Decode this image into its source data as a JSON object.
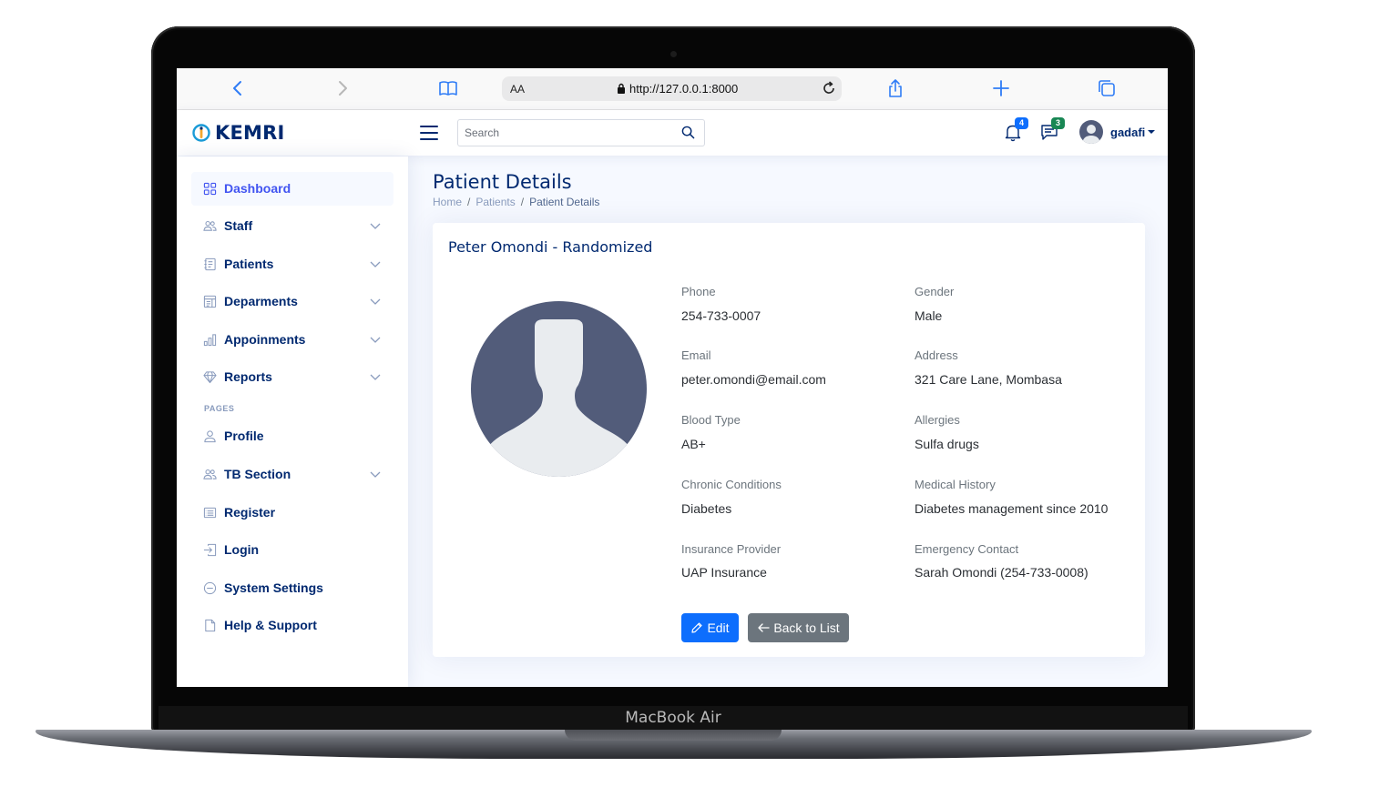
{
  "device": {
    "label": "MacBook Air"
  },
  "browser": {
    "aa_label": "AA",
    "url": "http://127.0.0.1:8000"
  },
  "header": {
    "logo_text": "KEMRI",
    "search_placeholder": "Search",
    "notifications_count": "4",
    "messages_count": "3",
    "user_name": "gadafi",
    "colors": {
      "primary": "#012970",
      "accent": "#4154f1",
      "notif_badge": "#0d6efd",
      "msg_badge": "#198754"
    }
  },
  "sidebar": {
    "items": [
      {
        "label": "Dashboard",
        "icon": "grid-icon",
        "has_children": false,
        "active": true
      },
      {
        "label": "Staff",
        "icon": "people-icon",
        "has_children": true
      },
      {
        "label": "Patients",
        "icon": "journal-text-icon",
        "has_children": true
      },
      {
        "label": "Deparments",
        "icon": "layout-text-window-icon",
        "has_children": true
      },
      {
        "label": "Appoinments",
        "icon": "bar-chart-icon",
        "has_children": true
      },
      {
        "label": "Reports",
        "icon": "gem-icon",
        "has_children": true
      }
    ],
    "pages_heading": "PAGES",
    "pages": [
      {
        "label": "Profile",
        "icon": "person-icon",
        "has_children": false
      },
      {
        "label": "TB Section",
        "icon": "people-icon",
        "has_children": true
      },
      {
        "label": "Register",
        "icon": "card-list-icon",
        "has_children": false
      },
      {
        "label": "Login",
        "icon": "box-arrow-in-right-icon",
        "has_children": false
      },
      {
        "label": "System Settings",
        "icon": "dash-circle-icon",
        "has_children": false
      },
      {
        "label": "Help & Support",
        "icon": "file-icon",
        "has_children": false
      }
    ]
  },
  "main": {
    "page_title": "Patient Details",
    "breadcrumb": [
      "Home",
      "Patients",
      "Patient Details"
    ],
    "card": {
      "title": "Peter Omondi - Randomized",
      "fields": [
        {
          "label": "Phone",
          "value": "254-733-0007"
        },
        {
          "label": "Gender",
          "value": "Male"
        },
        {
          "label": "Email",
          "value": "peter.omondi@email.com"
        },
        {
          "label": "Address",
          "value": "321 Care Lane, Mombasa"
        },
        {
          "label": "Blood Type",
          "value": "AB+"
        },
        {
          "label": "Allergies",
          "value": "Sulfa drugs"
        },
        {
          "label": "Chronic Conditions",
          "value": "Diabetes"
        },
        {
          "label": "Medical History",
          "value": "Diabetes management since 2010"
        },
        {
          "label": "Insurance Provider",
          "value": "UAP Insurance"
        },
        {
          "label": "Emergency Contact",
          "value": "Sarah Omondi (254-733-0008)"
        }
      ],
      "edit_label": "Edit",
      "back_label": "Back to List"
    }
  }
}
